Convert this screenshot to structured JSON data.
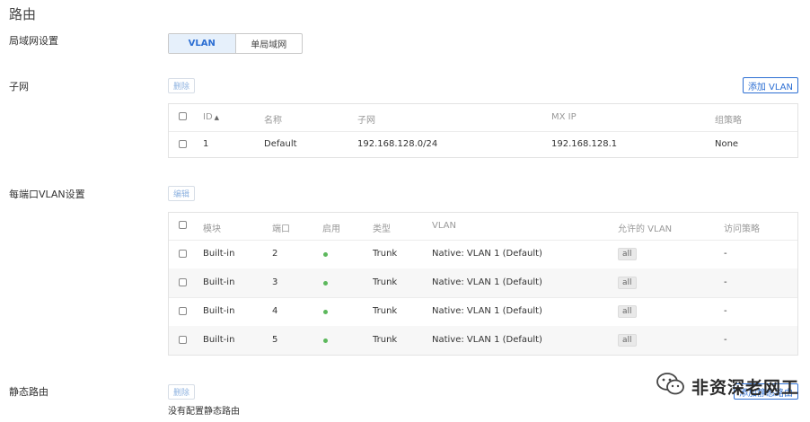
{
  "page": {
    "title": "路由"
  },
  "lan": {
    "label": "局域网设置",
    "options": [
      "VLAN",
      "单局域网"
    ],
    "selected": "VLAN"
  },
  "subnet": {
    "label": "子网",
    "delete_label": "删除",
    "add_label": "添加 VLAN",
    "columns": [
      "ID",
      "名称",
      "子网",
      "MX IP",
      "组策略"
    ],
    "sort_indicator": "▲",
    "rows": [
      {
        "id": "1",
        "name": "Default",
        "subnet": "192.168.128.0/24",
        "mx_ip": "192.168.128.1",
        "policy": "None"
      }
    ]
  },
  "port_vlan": {
    "label": "每端口VLAN设置",
    "edit_label": "编辑",
    "columns": [
      "模块",
      "端口",
      "启用",
      "类型",
      "VLAN",
      "允许的 VLAN",
      "访问策略"
    ],
    "enabled_color": "#5cb85c",
    "rows": [
      {
        "module": "Built-in",
        "port": "2",
        "enabled": true,
        "type": "Trunk",
        "vlan": "Native: VLAN 1 (Default)",
        "allowed": "all",
        "policy": "-"
      },
      {
        "module": "Built-in",
        "port": "3",
        "enabled": true,
        "type": "Trunk",
        "vlan": "Native: VLAN 1 (Default)",
        "allowed": "all",
        "policy": "-"
      },
      {
        "module": "Built-in",
        "port": "4",
        "enabled": true,
        "type": "Trunk",
        "vlan": "Native: VLAN 1 (Default)",
        "allowed": "all",
        "policy": "-"
      },
      {
        "module": "Built-in",
        "port": "5",
        "enabled": true,
        "type": "Trunk",
        "vlan": "Native: VLAN 1 (Default)",
        "allowed": "all",
        "policy": "-"
      }
    ]
  },
  "static_route": {
    "label": "静态路由",
    "delete_label": "删除",
    "add_label": "添加静态路由",
    "empty_text": "没有配置静态路由"
  },
  "watermark": {
    "text": "非资深老网工",
    "icon": "wechat-icon"
  },
  "colors": {
    "accent": "#2d6fd3",
    "accent_bg": "#e6f0fb"
  }
}
